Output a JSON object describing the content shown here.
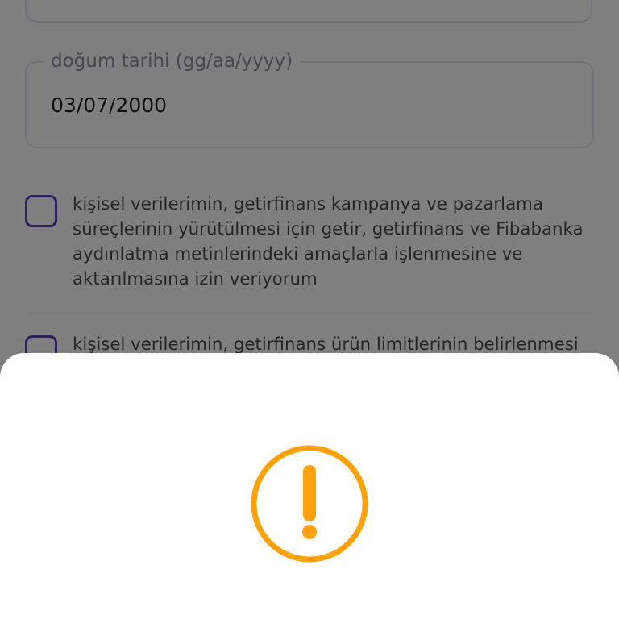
{
  "birth_date": {
    "label": "doğum tarihi (gg/aa/yyyy)",
    "value": "03/07/2000"
  },
  "consents": [
    {
      "checked": false,
      "lines": [
        "kişisel verilerimin, getirfinans kampanya ve pazarlama",
        "süreçlerinin yürütülmesi için getir, getirfinans ve Fibabanka",
        "aydınlatma metinlerindeki amaçlarla işlenmesine ve",
        "aktarılmasına izin veriyorum"
      ]
    },
    {
      "checked": false,
      "lines": [
        "kişisel verilerimin, getirfinans ürün limitlerinin belirlenmesi"
      ]
    }
  ],
  "bottom_sheet": {
    "icon": "exclamation-circle-icon"
  },
  "colors": {
    "brand_purple": "#5d3ebc",
    "warning_orange": "#ffa10a",
    "scrim": "rgba(0,0,0,0.5)"
  }
}
